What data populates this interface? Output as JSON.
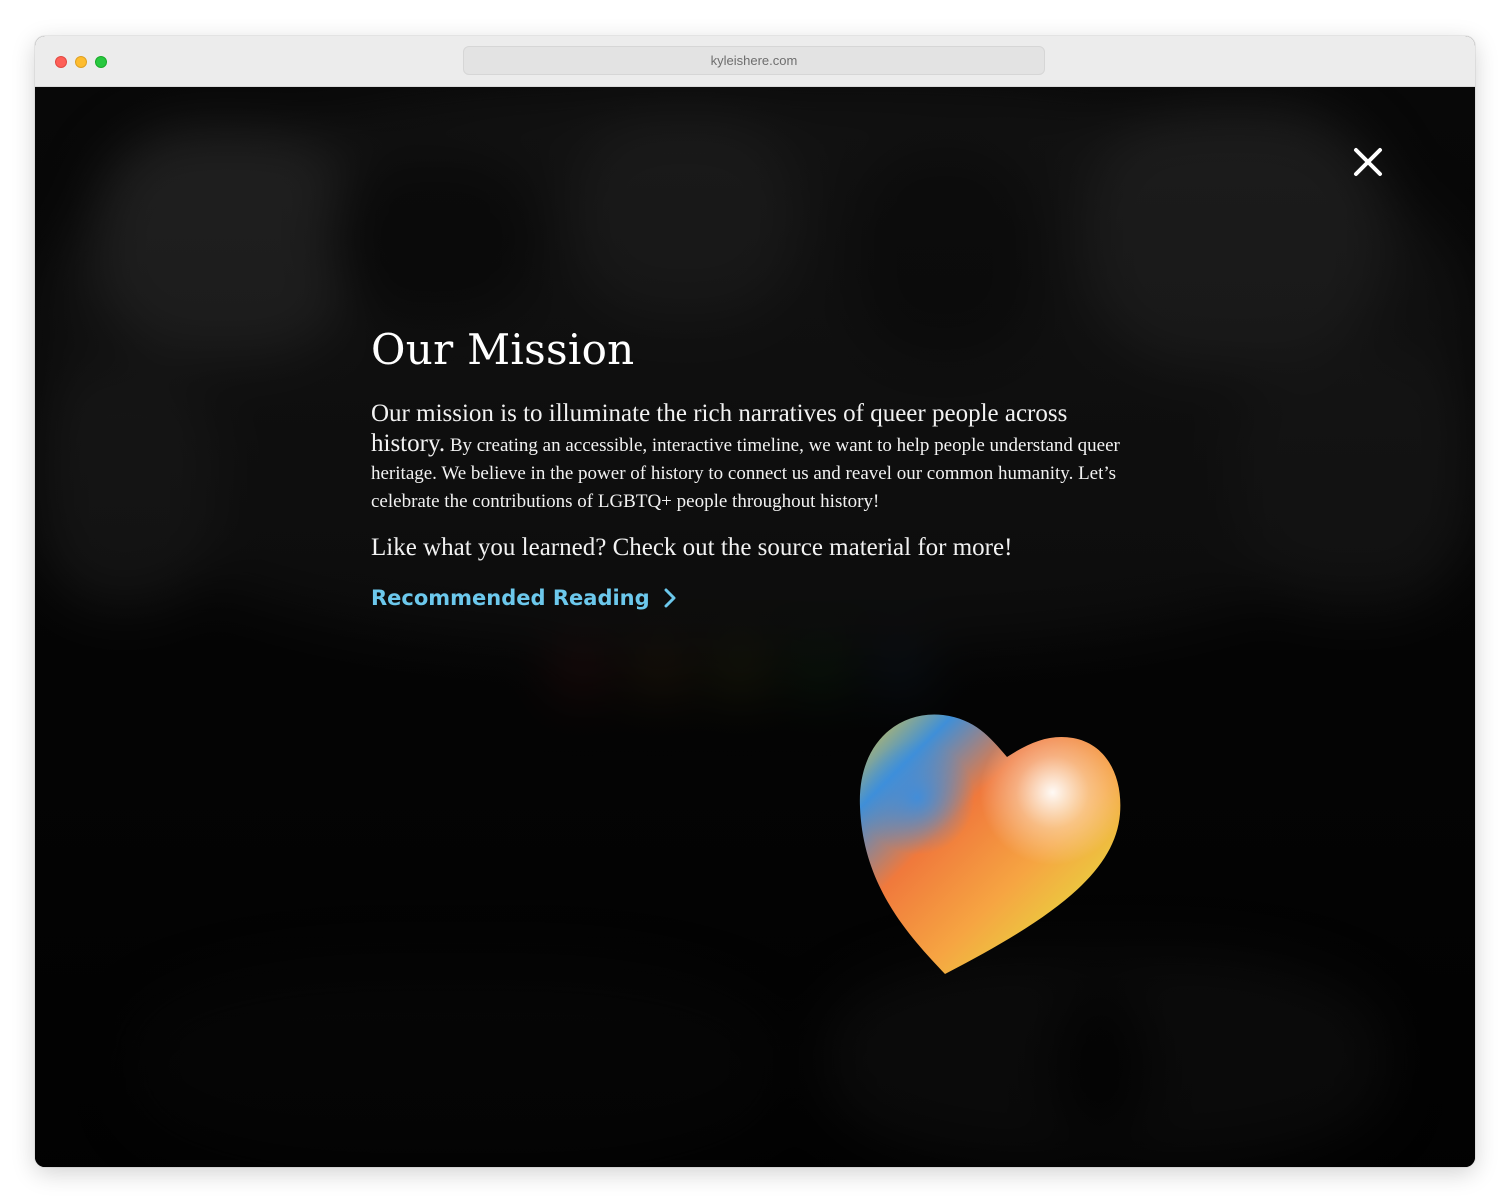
{
  "browser": {
    "url": "kyleishere.com"
  },
  "modal": {
    "close_icon": "close-icon",
    "title": "Our Mission",
    "lead": "Our mission is to illuminate the rich narratives of queer people across history.",
    "body": "By creating an accessible, interactive timeline, we want to help people understand queer heritage. We believe in the power of history to connect us and reavel our common humanity. Let’s celebrate the contributions of LGBTQ+ people throughout history!",
    "cta": "Like what you learned? Check out the source material for more!",
    "link_label": "Recommended Reading",
    "link_icon": "chevron-right-icon",
    "decoration": "rainbow-heart-icon"
  },
  "colors": {
    "background": "#000000",
    "text": "#ffffff",
    "link": "#6cc8ec",
    "titlebar": "#ececec"
  }
}
